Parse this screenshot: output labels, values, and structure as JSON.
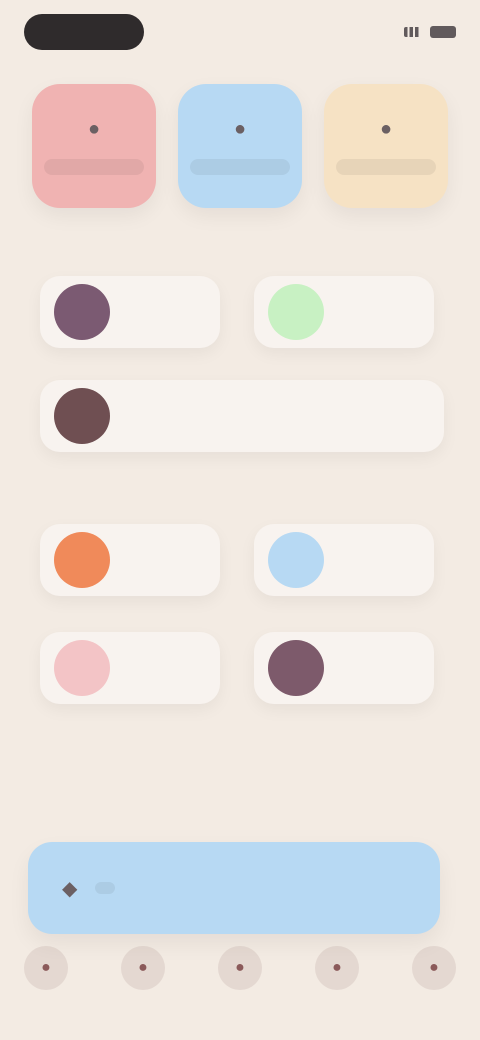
{
  "status_bar": {
    "time": "",
    "icons": [
      "signal-icon",
      "battery-icon"
    ]
  },
  "tiles": [
    {
      "label": "",
      "icon": "●",
      "color": "#f0b3b2"
    },
    {
      "label": "",
      "icon": "●",
      "color": "#b7d9f3"
    },
    {
      "label": "",
      "icon": "●",
      "color": "#f6e2c4"
    }
  ],
  "sections": {
    "first_title": "",
    "second_title": "",
    "third_title": ""
  },
  "cards_row1": [
    {
      "label": "",
      "dot_color": "#7b5a72"
    },
    {
      "label": "",
      "dot_color": "#c8f1c3"
    }
  ],
  "card_full": {
    "label": "",
    "dot_color": "#6f4f52"
  },
  "cards_row2": [
    {
      "label": "",
      "dot_color": "#f08a5a"
    },
    {
      "label": "",
      "dot_color": "#b7d9f3"
    }
  ],
  "cards_row3": [
    {
      "label": "",
      "dot_color": "#f3c4c6"
    },
    {
      "label": "",
      "dot_color": "#7d5a6b"
    }
  ],
  "hint_text": "",
  "cta": {
    "label": "",
    "icon": "◆"
  },
  "nav": [
    {
      "icon": "●"
    },
    {
      "icon": "●"
    },
    {
      "icon": "●"
    },
    {
      "icon": "●"
    },
    {
      "icon": "●"
    }
  ]
}
